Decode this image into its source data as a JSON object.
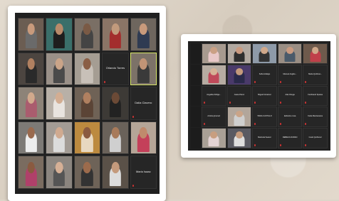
{
  "left_panel": {
    "tiles": [
      {
        "kind": "video",
        "name": "",
        "bg": "#6b5d52",
        "skin": "#c89a7c",
        "cloth": "#6a6a6a"
      },
      {
        "kind": "video",
        "name": "",
        "bg": "#3a6f6a",
        "skin": "#b88a6a",
        "cloth": "#1e1e1e"
      },
      {
        "kind": "video",
        "name": "",
        "bg": "#7a6f65",
        "skin": "#7a5a45",
        "cloth": "#444"
      },
      {
        "kind": "video",
        "name": "",
        "bg": "#8a7566",
        "skin": "#c19a7c",
        "cloth": "#a32d2d"
      },
      {
        "kind": "video",
        "name": "",
        "bg": "#6e665e",
        "skin": "#c89a7c",
        "cloth": "#2f3b52"
      },
      {
        "kind": "video",
        "name": "",
        "bg": "#4c4540",
        "skin": "#b08060",
        "cloth": "#2a2a2a"
      },
      {
        "kind": "video",
        "name": "",
        "bg": "#9a9088",
        "skin": "#caa488",
        "cloth": "#4a4a4a"
      },
      {
        "kind": "video",
        "name": "",
        "bg": "#a59d93",
        "skin": "#8a5e45",
        "cloth": "#c8c0b8"
      },
      {
        "kind": "label",
        "name": "",
        "label": "Orlando Torres"
      },
      {
        "kind": "video",
        "active": true,
        "name": "",
        "bg": "#7c7268",
        "skin": "#c29476",
        "cloth": "#3a3a3a"
      },
      {
        "kind": "video",
        "name": "",
        "bg": "#8d8378",
        "skin": "#d1a98c",
        "cloth": "#aa5c6e"
      },
      {
        "kind": "video",
        "name": "",
        "bg": "#b8b0a7",
        "skin": "#d3ad92",
        "cloth": "#e9e4df"
      },
      {
        "kind": "video",
        "name": "",
        "bg": "#6f6256",
        "skin": "#b08060",
        "cloth": "#5b4436"
      },
      {
        "kind": "video",
        "name": "",
        "bg": "#3d3a36",
        "skin": "#6b4a36",
        "cloth": "#222"
      },
      {
        "kind": "label",
        "name": "",
        "label": "Dalia Clavero"
      },
      {
        "kind": "video",
        "name": "",
        "bg": "#7d7a76",
        "skin": "#9a6a4e",
        "cloth": "#ededed"
      },
      {
        "kind": "video",
        "name": "",
        "bg": "#a39c95",
        "skin": "#d0aa90",
        "cloth": "#dcdcdc"
      },
      {
        "kind": "video",
        "name": "",
        "bg": "#bc8a3f",
        "skin": "#8a5a40",
        "cloth": "#e8d8c0"
      },
      {
        "kind": "video",
        "name": "",
        "bg": "#6a625a",
        "skin": "#a87a5a",
        "cloth": "#cfcfcf"
      },
      {
        "kind": "video",
        "name": "",
        "bg": "#b5a597",
        "skin": "#c08a6c",
        "cloth": "#c4405a"
      },
      {
        "kind": "video",
        "name": "",
        "bg": "#7a6c60",
        "skin": "#8a5a40",
        "cloth": "#b0406a"
      },
      {
        "kind": "video",
        "name": "",
        "bg": "#8b857f",
        "skin": "#d6b096",
        "cloth": "#555"
      },
      {
        "kind": "video",
        "name": "",
        "bg": "#6e6358",
        "skin": "#9c6b4c",
        "cloth": "#333"
      },
      {
        "kind": "video",
        "name": "",
        "bg": "#5a5148",
        "skin": "#c49a7c",
        "cloth": "#dcdcdc"
      },
      {
        "kind": "label",
        "name": "",
        "label": "Mario Isaac"
      }
    ]
  },
  "right_panel": {
    "tiles": [
      {
        "kind": "blank"
      },
      {
        "kind": "video",
        "name": "",
        "bg": "#a79a8f",
        "skin": "#caa084",
        "cloth": "#e8c8c8"
      },
      {
        "kind": "video",
        "name": "",
        "bg": "#b1a8a0",
        "skin": "#c99a80",
        "cloth": "#2e2e2e"
      },
      {
        "kind": "video",
        "name": "",
        "bg": "#8e9aa8",
        "skin": "#d0a88a",
        "cloth": "#333"
      },
      {
        "kind": "video",
        "name": "",
        "bg": "#9a8e84",
        "skin": "#c99a80",
        "cloth": "#4a5a6a"
      },
      {
        "kind": "video",
        "name": "",
        "bg": "#6e5a4c",
        "skin": "#d0a88a",
        "cloth": "#c0404a"
      },
      {
        "kind": "blank"
      },
      {
        "kind": "video",
        "name": "",
        "bg": "#b6aca2",
        "skin": "#d6b296",
        "cloth": "#c04a5a"
      },
      {
        "kind": "video",
        "name": "",
        "bg": "#4a3a6a",
        "skin": "#c49a7c",
        "cloth": "#2a2a4a"
      },
      {
        "kind": "label",
        "name": "",
        "label": "Sofia Hidalgo"
      },
      {
        "kind": "label",
        "name": "",
        "label": "Manuel Anglés..."
      },
      {
        "kind": "label",
        "name": "",
        "label": "Maria Quiñone..."
      },
      {
        "kind": "blank"
      },
      {
        "kind": "label",
        "name": "",
        "label": "Angelita Zúñiga..."
      },
      {
        "kind": "label",
        "name": "",
        "label": "Juana Pérez"
      },
      {
        "kind": "label",
        "name": "",
        "label": "Miguel Giménez"
      },
      {
        "kind": "label",
        "name": "",
        "label": "Ada Ortega"
      },
      {
        "kind": "label",
        "name": "",
        "label": "Ferdinand Sparas"
      },
      {
        "kind": "blank"
      },
      {
        "kind": "label",
        "name": "",
        "label": "cristina jimenez"
      },
      {
        "kind": "video",
        "name": "",
        "bg": "#b2a69b",
        "skin": "#caa488",
        "cloth": "#cfcfcf"
      },
      {
        "kind": "label",
        "name": "",
        "label": "TANIA CASTILLO"
      },
      {
        "kind": "label",
        "name": "",
        "label": "katherine rosa"
      },
      {
        "kind": "label",
        "name": "",
        "label": "Keila Manzanares"
      },
      {
        "kind": "blank"
      },
      {
        "kind": "video",
        "name": "",
        "bg": "#a9a096",
        "skin": "#c89e80",
        "cloth": "#e3d3d3"
      },
      {
        "kind": "video",
        "name": "",
        "bg": "#5a5a62",
        "skin": "#c49a7c",
        "cloth": "#dedede"
      },
      {
        "kind": "label",
        "name": "",
        "label": "Maricela Suarez"
      },
      {
        "kind": "label",
        "name": "",
        "label": "REBECA DURAN"
      },
      {
        "kind": "label",
        "name": "",
        "label": "Imelo Quiñonez"
      }
    ]
  }
}
